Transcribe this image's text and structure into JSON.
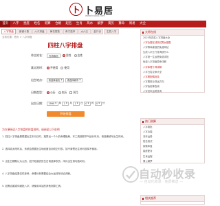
{
  "site": {
    "logo_char": "卜",
    "name": "卜易居",
    "url": "www.buyiju.com"
  },
  "nav": [
    "首页",
    "八字",
    "星座",
    "姓名",
    "测算",
    "合婚",
    "起名",
    "生肖",
    "风水",
    "解梦",
    "黄历",
    "算命",
    "周易",
    "大全"
  ],
  "subnav": [
    "八字排盘",
    "紫微斗数",
    "六爻排盘",
    "梅花易数",
    "奇门遁甲",
    "大六壬",
    "金口诀",
    "生辰八字"
  ],
  "breadcrumb": "当前位置：首页 > 八字排盘",
  "form": {
    "title": "四柱八字排盘",
    "name_label": "命主姓名：",
    "name_value": "在线取名",
    "gender_label": "性别：",
    "gender_male": "男性",
    "gender_female": "女性",
    "zhi_label": "真太阳时：",
    "zhi_no": "不使用",
    "zhi_yes": "使用",
    "birthplace_label": "出生地点：",
    "birthplace_value": "请选择省份",
    "birthplace_city": "请选择城市",
    "calendar_label": "日期类型：",
    "calendar_solar": "公历",
    "calendar_lunar": "农历",
    "calendar_leap": "闰月",
    "birth_label": "出生日期：",
    "year": "1990",
    "year_unit": "年",
    "month": "1",
    "month_unit": "月",
    "day": "1",
    "day_unit": "日",
    "hour": "0",
    "hour_unit": "时",
    "minute": "0",
    "minute_unit": "分",
    "submit": "开始排盘"
  },
  "intro": {
    "red": "为方便阅读八字排盘的排盘说明，请阅读以下说明",
    "items": [
      "1. 四柱八字排盘是根据出生年月日时，推算出一个人的命理格局，本工具按照节气划分年月，请准确填写出生时间。",
      "2. 选择真太阳时后，系统会根据出生地经度自动校正时辰，如不清楚出生地可选择不使用。",
      "3. 出生日期默认为公历，如只知道农历生日请选择农历，闰月出生请勾选闰月。",
      "4. 八字排盘结果仅供参考，命理分析需要结合大运流年综合判断。",
      "5. 如需合婚或详细批八字，请使用本站的其他测算工具。"
    ]
  },
  "sidebar": {
    "box1": {
      "title": "大师在线",
      "items": [
        "2025年四柱八字排盘大全",
        "八字合婚在线测试男女婚配",
        "八字算命最准的免费网站",
        "生辰八字五行查询缺什么",
        "八字测一生运势免费详批",
        "免费八字排盘算命详解",
        "八字命理十神详解",
        "八字日柱论命大全",
        "八字看配偶信息",
        "八字看事业财运方向",
        "八字喜用神查询",
        "八字流年运势查询"
      ]
    },
    "box2": {
      "title": "热门测算",
      "items": [
        "八字精批",
        "八字合婚",
        "流年运势",
        "姓名测试",
        "紫微命盘",
        "星座配对",
        "生肖运程",
        "周公解梦"
      ]
    },
    "box3": {
      "title": "相关推荐"
    }
  },
  "watermark": {
    "title": "自动秒收录",
    "subtitle": "— 自动化收录 · 免费推送 —"
  },
  "colors": {
    "brand": "#b71c1c",
    "accent": "#f08a2c",
    "nav_bg": "#b71c1c"
  }
}
